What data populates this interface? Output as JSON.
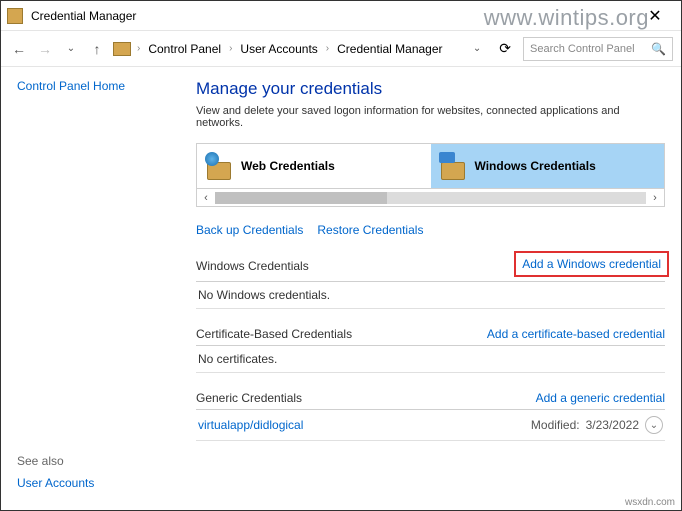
{
  "window": {
    "title": "Credential Manager"
  },
  "watermark": "www.wintips.org",
  "breadcrumb": {
    "items": [
      "Control Panel",
      "User Accounts",
      "Credential Manager"
    ]
  },
  "search": {
    "placeholder": "Search Control Panel"
  },
  "sidebar": {
    "home": "Control Panel Home",
    "see_also": "See also",
    "user_accounts": "User Accounts"
  },
  "page": {
    "title": "Manage your credentials",
    "description": "View and delete your saved logon information for websites, connected applications and networks."
  },
  "tabs": {
    "web": "Web Credentials",
    "windows": "Windows Credentials"
  },
  "actions": {
    "backup": "Back up Credentials",
    "restore": "Restore Credentials"
  },
  "sections": {
    "windows": {
      "title": "Windows Credentials",
      "add": "Add a Windows credential",
      "empty": "No Windows credentials."
    },
    "cert": {
      "title": "Certificate-Based Credentials",
      "add": "Add a certificate-based credential",
      "empty": "No certificates."
    },
    "generic": {
      "title": "Generic Credentials",
      "add": "Add a generic credential",
      "item_name": "virtualapp/didlogical",
      "item_modified_label": "Modified:",
      "item_modified_date": "3/23/2022"
    }
  },
  "source": "wsxdn.com"
}
